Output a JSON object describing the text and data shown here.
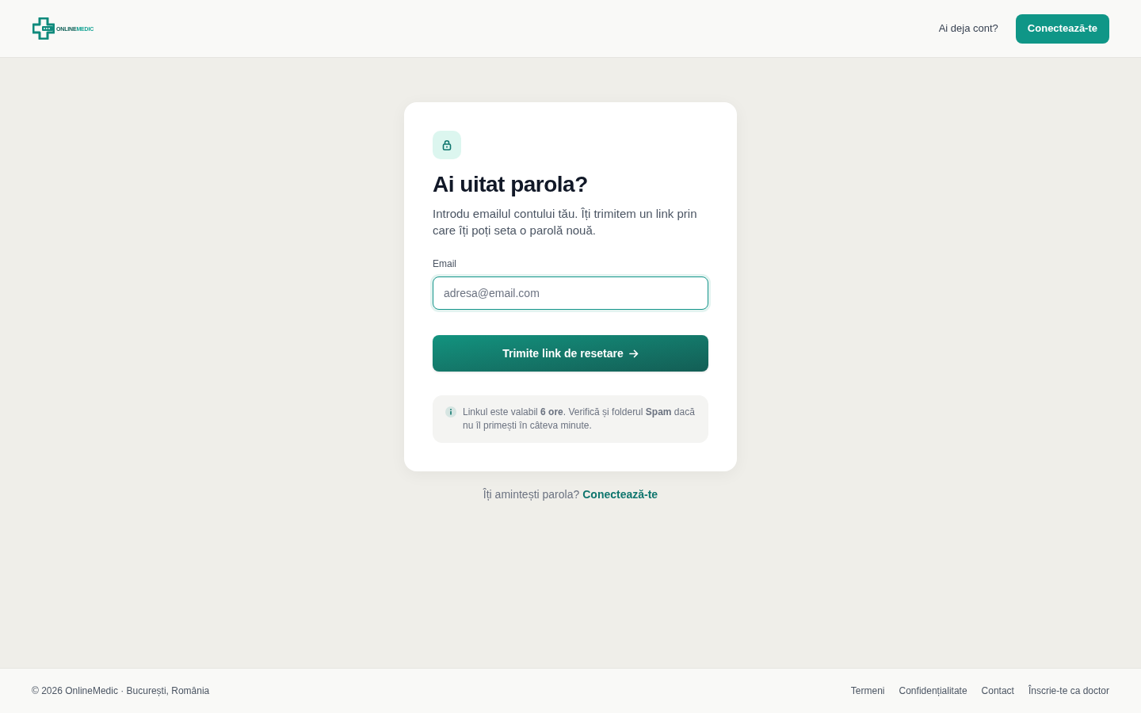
{
  "header": {
    "logo": {
      "text_main": "ONLINE",
      "text_accent": "MEDIC"
    },
    "account_prompt": "Ai deja cont?",
    "login_button": "Conectează-te"
  },
  "card": {
    "title": "Ai uitat parola?",
    "description": "Introdu emailul contului tău. Îți trimitem un link prin care îți poți seta o parolă nouă.",
    "email_field": {
      "label": "Email",
      "placeholder": "adresa@email.com",
      "focused": true
    },
    "submit_button": "Trimite link de resetare",
    "info_note": "Linkul este valabil **6 ore**. Verifică și folderul **Spam** dacă nu îl primești în câteva minute."
  },
  "remember_prompt": {
    "text": "Îți amintești parola?",
    "link": "Conectează-te"
  },
  "footer": {
    "copyright": "© 2026 OnlineMedic · București, România",
    "links": [
      "Termeni",
      "Confidențialitate",
      "Contact",
      "Înscrie-te ca doctor"
    ]
  }
}
